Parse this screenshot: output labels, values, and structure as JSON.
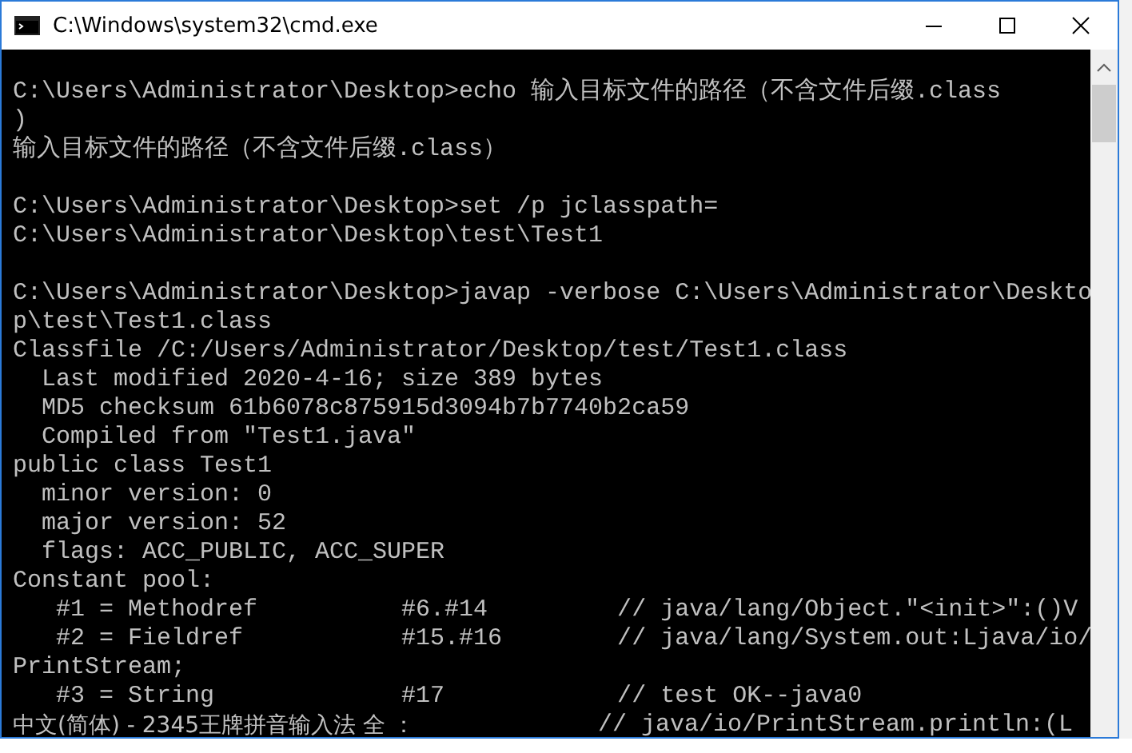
{
  "window": {
    "title": "C:\\Windows\\system32\\cmd.exe"
  },
  "console": {
    "lines": [
      {
        "kind": "blank"
      },
      {
        "kind": "text",
        "text": "C:\\Users\\Administrator\\Desktop>echo 输入目标文件的路径（不含文件后缀.class"
      },
      {
        "kind": "text",
        "text": ")"
      },
      {
        "kind": "text",
        "text": "输入目标文件的路径（不含文件后缀.class）"
      },
      {
        "kind": "blank"
      },
      {
        "kind": "text",
        "text": "C:\\Users\\Administrator\\Desktop>set /p jclasspath="
      },
      {
        "kind": "text",
        "text": "C:\\Users\\Administrator\\Desktop\\test\\Test1"
      },
      {
        "kind": "blank"
      },
      {
        "kind": "text",
        "text": "C:\\Users\\Administrator\\Desktop>javap -verbose C:\\Users\\Administrator\\Deskto"
      },
      {
        "kind": "text",
        "text": "p\\test\\Test1.class"
      },
      {
        "kind": "text",
        "text": "Classfile /C:/Users/Administrator/Desktop/test/Test1.class"
      },
      {
        "kind": "text",
        "text": "  Last modified 2020-4-16; size 389 bytes"
      },
      {
        "kind": "text",
        "text": "  MD5 checksum 61b6078c875915d3094b7b7740b2ca59"
      },
      {
        "kind": "text",
        "text": "  Compiled from \"Test1.java\""
      },
      {
        "kind": "text",
        "text": "public class Test1"
      },
      {
        "kind": "text",
        "text": "  minor version: 0"
      },
      {
        "kind": "text",
        "text": "  major version: 52"
      },
      {
        "kind": "text",
        "text": "  flags: ACC_PUBLIC, ACC_SUPER"
      },
      {
        "kind": "text",
        "text": "Constant pool:"
      },
      {
        "kind": "text",
        "text": "   #1 = Methodref          #6.#14         // java/lang/Object.\"<init>\":()V"
      },
      {
        "kind": "text",
        "text": "   #2 = Fieldref           #15.#16        // java/lang/System.out:Ljava/io/"
      },
      {
        "kind": "text",
        "text": "PrintStream;"
      },
      {
        "kind": "text",
        "text": "   #3 = String             #17            // test OK--java0"
      }
    ],
    "ime_status": "中文(简体) - 2345王牌拼音输入法 全 ：",
    "last_line_visible": "// java/io/PrintStream.println:(L"
  }
}
